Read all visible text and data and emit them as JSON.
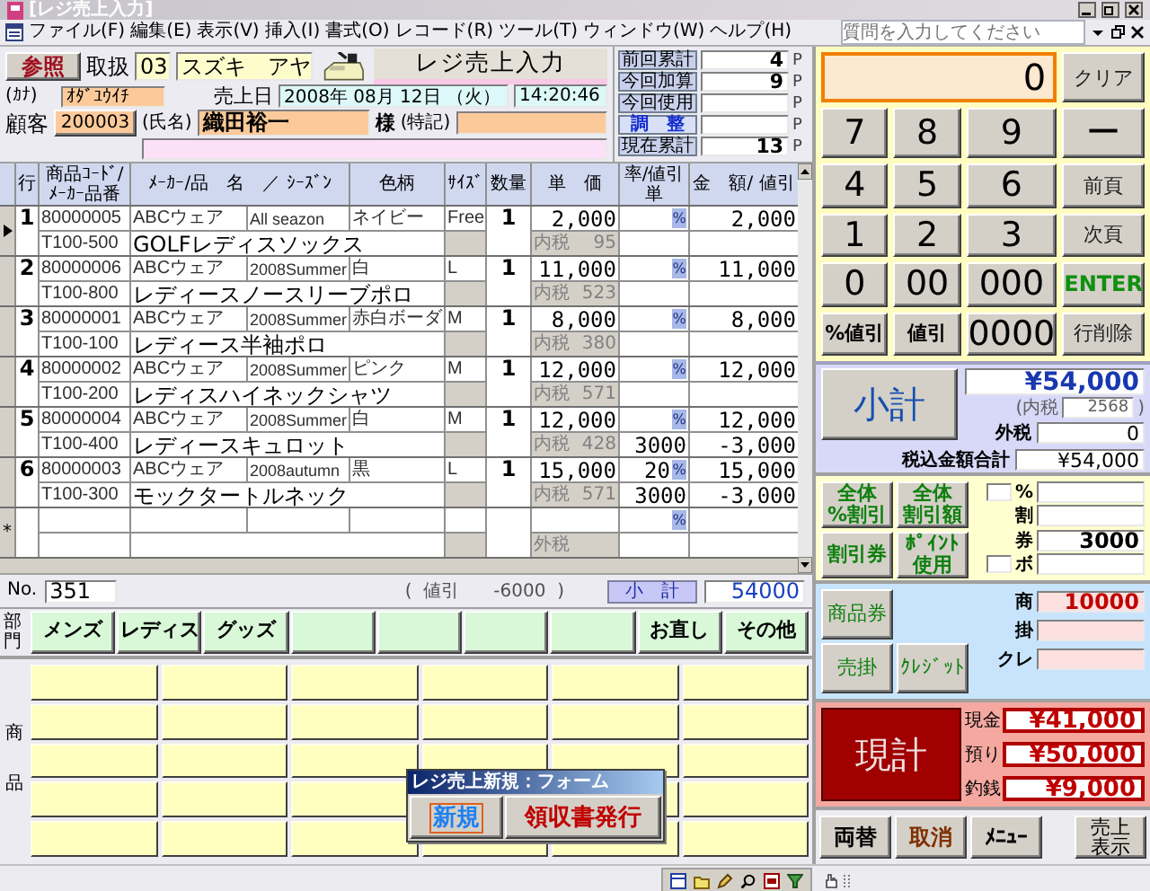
{
  "window": {
    "title": "[レジ売上入力]"
  },
  "menu": [
    "ファイル(F)",
    "編集(E)",
    "表示(V)",
    "挿入(I)",
    "書式(O)",
    "レコード(R)",
    "ツール(T)",
    "ウィンドウ(W)",
    "ヘルプ(H)"
  ],
  "help_search": {
    "placeholder": "質問を入力してください"
  },
  "header": {
    "lookup_button": "参照",
    "handler_label": "取扱",
    "handler_code": "03",
    "handler_name": "スズキ　アヤ",
    "form_title": "レジ売上入力",
    "sale_date_label": "売上日",
    "sale_date": "2008年 08月 12日 （火）",
    "sale_time": "14:20:46",
    "kana_label": "(ｶﾅ)",
    "kana": "ｵﾀﾞﾕｳｲﾁ",
    "customer_label": "顧客",
    "customer_code": "200003",
    "name_label": "(氏名)",
    "customer_name": "織田裕一",
    "honorific": "様",
    "note_label": "(特記)"
  },
  "points": [
    {
      "label": "前回累計",
      "kind": "label",
      "value": "4",
      "unit": "P"
    },
    {
      "label": "今回加算",
      "kind": "label",
      "value": "9",
      "unit": "P"
    },
    {
      "label": "今回使用",
      "kind": "label",
      "unit": "P"
    },
    {
      "label": "調　整",
      "kind": "button",
      "unit": "P"
    },
    {
      "label": "現在累計",
      "kind": "label",
      "value": "13",
      "unit": "P"
    }
  ],
  "table": {
    "columns": [
      "行",
      "商品ｺｰﾄﾞ/ﾒｰｶｰ品番",
      "ﾒｰｶｰ/品　名　／ ｼｰｽﾞﾝ",
      "色柄",
      "ｻｲｽﾞ",
      "数量",
      "単　価",
      "率/値引単",
      "金　額/ 値引"
    ],
    "rows": [
      {
        "current": true,
        "no": "1",
        "code": "80000005",
        "maker_code": "T100-500",
        "maker": "ABCウェア",
        "season": "All seazon",
        "name": "GOLFレディスソックス",
        "color_pattern": "ネイビー",
        "size": "Free",
        "qty": "1",
        "price": "2,000",
        "tax_label": "内税",
        "tax": "95",
        "rate_button": "%",
        "amount": "2,000"
      },
      {
        "current": false,
        "no": "2",
        "code": "80000006",
        "maker_code": "T100-800",
        "maker": "ABCウェア",
        "season": "2008Summer",
        "name": "レディースノースリーブポロ",
        "color_pattern": "白",
        "size": "L",
        "qty": "1",
        "price": "11,000",
        "tax_label": "内税",
        "tax": "523",
        "rate_button": "%",
        "amount": "11,000"
      },
      {
        "current": false,
        "no": "3",
        "code": "80000001",
        "maker_code": "T100-100",
        "maker": "ABCウェア",
        "season": "2008Summer",
        "name": "レディース半袖ポロ",
        "color_pattern": "赤白ボーダ",
        "size": "M",
        "qty": "1",
        "price": "8,000",
        "tax_label": "内税",
        "tax": "380",
        "rate_button": "%",
        "amount": "8,000"
      },
      {
        "current": false,
        "no": "4",
        "code": "80000002",
        "maker_code": "T100-200",
        "maker": "ABCウェア",
        "season": "2008Summer",
        "name": "レディスハイネックシャツ",
        "color_pattern": "ピンク",
        "size": "M",
        "qty": "1",
        "price": "12,000",
        "tax_label": "内税",
        "tax": "571",
        "rate_button": "%",
        "amount": "12,000"
      },
      {
        "current": false,
        "no": "5",
        "code": "80000004",
        "maker_code": "T100-400",
        "maker": "ABCウェア",
        "season": "2008Summer",
        "name": "レディースキュロット",
        "color_pattern": "白",
        "size": "M",
        "qty": "1",
        "price": "12,000",
        "tax_label": "内税",
        "tax": "428",
        "rate_button": "%",
        "discount": "3000",
        "amount": "12,000",
        "amount2": "-3,000"
      },
      {
        "current": false,
        "no": "6",
        "code": "80000003",
        "maker_code": "T100-300",
        "maker": "ABCウェア",
        "season": "2008autumn",
        "name": "モックタートルネック",
        "color_pattern": "黒",
        "size": "L",
        "qty": "1",
        "price": "15,000",
        "tax_label": "内税",
        "tax": "571",
        "rate": "20",
        "rate_button": "%",
        "discount": "3000",
        "amount": "15,000",
        "amount2": "-3,000"
      }
    ],
    "new_row": {
      "marker": "*",
      "rate_button": "%",
      "tax_label": "外税"
    }
  },
  "footer": {
    "no_label": "No.",
    "no": "351",
    "discount": "(  値引      -6000  )",
    "subtotal_label": "小　計",
    "subtotal": "54000"
  },
  "departments": {
    "label": "部門",
    "buttons": [
      {
        "kind": "label",
        "label": "メンズ"
      },
      {
        "kind": "label",
        "label": "レディス"
      },
      {
        "kind": "label",
        "label": "グッズ"
      },
      {
        "kind": "blank"
      },
      {
        "kind": "blank"
      },
      {
        "kind": "blank"
      },
      {
        "kind": "blank"
      },
      {
        "kind": "label",
        "label": "お直し"
      },
      {
        "kind": "label",
        "label": "その他"
      }
    ]
  },
  "products": {
    "label": "商品"
  },
  "dialog": {
    "title": "レジ売上新規：フォーム",
    "buttons": [
      {
        "label": "新規",
        "kind": "new",
        "focused": true
      },
      {
        "label": "領収書発行",
        "kind": "issue",
        "focused": false
      }
    ]
  },
  "keypad": {
    "display": "0",
    "clear_key": "クリア",
    "keys": [
      {
        "label": "7",
        "kind": "num"
      },
      {
        "label": "8",
        "kind": "num"
      },
      {
        "label": "9",
        "kind": "num"
      },
      {
        "label": "ー",
        "kind": "num"
      },
      {
        "label": "4",
        "kind": "num"
      },
      {
        "label": "5",
        "kind": "num"
      },
      {
        "label": "6",
        "kind": "num"
      },
      {
        "label": "前頁",
        "kind": "func"
      },
      {
        "label": "1",
        "kind": "num"
      },
      {
        "label": "2",
        "kind": "num"
      },
      {
        "label": "3",
        "kind": "num"
      },
      {
        "label": "次頁",
        "kind": "func"
      },
      {
        "label": "0",
        "kind": "num"
      },
      {
        "label": "00",
        "kind": "num"
      },
      {
        "label": "000",
        "kind": "num"
      },
      {
        "label": "ENTER",
        "kind": "enter"
      },
      {
        "label": "%値引",
        "kind": "disc"
      },
      {
        "label": "値引",
        "kind": "disc"
      },
      {
        "label": "0000",
        "kind": "num"
      },
      {
        "label": "行削除",
        "kind": "func"
      }
    ]
  },
  "subtotal": {
    "button": "小計",
    "total": "¥54,000",
    "inner_tax_label": "(内税",
    "inner_tax": "2568",
    "inner_tax_end": ")",
    "outer_tax_label": "外税",
    "outer_tax": "0",
    "total_label": "税込金額合計",
    "grand_total": "¥54,000"
  },
  "discounts": {
    "buttons": [
      [
        "全体",
        "%割引"
      ],
      [
        "全体",
        "割引額"
      ],
      [
        "割引券"
      ],
      [
        "ﾎﾟｲﾝﾄ",
        "使用"
      ]
    ],
    "fields": [
      {
        "label": "%",
        "has_box": true
      },
      {
        "label": "割",
        "has_box": false
      },
      {
        "label": "券",
        "has_box": false,
        "value": "3000"
      },
      {
        "label": "ボ",
        "has_box": true
      }
    ]
  },
  "payments": {
    "buttons": [
      "商品券",
      "売掛",
      "ｸﾚｼﾞｯﾄ"
    ],
    "fields": [
      {
        "label": "商",
        "value": "10000"
      },
      {
        "label": "掛"
      },
      {
        "label": "クレ"
      }
    ]
  },
  "cash": {
    "button": "現計",
    "fields": [
      {
        "label": "現金",
        "value": "¥41,000"
      },
      {
        "label": "預り",
        "value": "¥50,000"
      },
      {
        "label": "釣銭",
        "value": "¥9,000"
      }
    ]
  },
  "actions": [
    {
      "lines": [
        "両替"
      ],
      "kind": "normal"
    },
    {
      "lines": [
        "取消"
      ],
      "kind": "cancel"
    },
    {
      "lines": [
        "ﾒﾆｭｰ"
      ],
      "kind": "normal"
    },
    {
      "lines": [
        "売上",
        "表示"
      ],
      "kind": "normal"
    }
  ]
}
